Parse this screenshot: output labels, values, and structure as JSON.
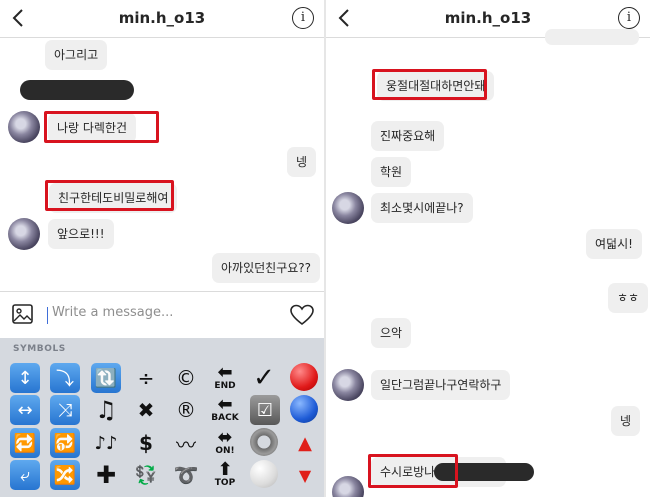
{
  "left": {
    "header": {
      "title": "min.h_o13"
    },
    "messages": [
      "아그리고",
      "나랑 다렉한건",
      "넹",
      "친구한테도비밀로해여",
      "앞으로!!!",
      "아까있던친구요??"
    ],
    "composer": {
      "placeholder": "Write a message..."
    },
    "keyboard": {
      "label": "SYMBOLS",
      "keys": [
        "↕",
        "⤵",
        "🔃",
        "÷",
        "©",
        "END",
        "✓",
        "●",
        "↔",
        "⤨",
        "♫",
        "✖",
        "®",
        "BACK",
        "☑",
        "●",
        "🔁",
        "🔂",
        "♪♪",
        "$",
        "〰",
        "ON!",
        "◉",
        "▲",
        "⤶",
        "🔀",
        "✚",
        "💱",
        "➰",
        "TOP",
        "●",
        "▼"
      ]
    }
  },
  "right": {
    "header": {
      "title": "min.h_o13"
    },
    "messages": [
      "웅절대절대하면안돼",
      "진짜중요해",
      "학원",
      "최소몇시에끝나?",
      "여덟시!",
      "ㅎㅎ",
      "으악",
      "일단그럼끝나구연락하구",
      "넹",
      "수시로방나가"
    ]
  },
  "colors": {
    "highlight": "#d8131f",
    "bubble": "#efefef",
    "keyboard": "#d5d9df"
  }
}
